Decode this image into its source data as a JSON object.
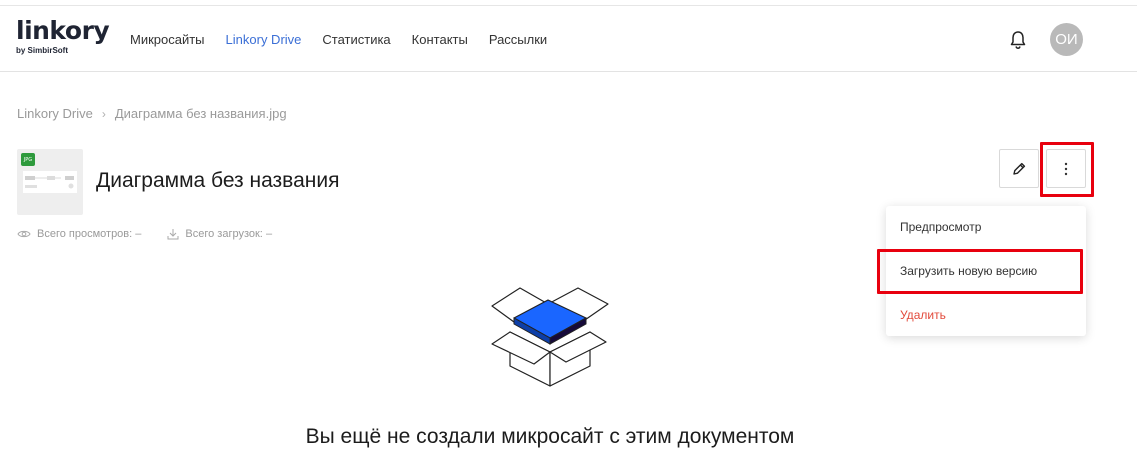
{
  "header": {
    "logo_text": "linkory",
    "logo_sub": "by SimbirSoft",
    "nav": [
      {
        "label": "Микросайты"
      },
      {
        "label": "Linkory Drive",
        "active": true
      },
      {
        "label": "Статистика"
      },
      {
        "label": "Контакты"
      },
      {
        "label": "Рассылки"
      }
    ],
    "bell_icon": "bell-icon",
    "avatar_initials": "ОИ"
  },
  "breadcrumb": {
    "root": "Linkory Drive",
    "current": "Диаграмма без названия.jpg"
  },
  "document": {
    "title": "Диаграмма без названия",
    "thumb_badge": "JPG",
    "views_label": "Всего просмотров:",
    "views_value": "–",
    "downloads_label": "Всего загрузок:",
    "downloads_value": "–"
  },
  "actions": {
    "edit_icon": "pencil-icon",
    "more_icon": "kebab-icon"
  },
  "menu": {
    "preview": "Предпросмотр",
    "upload_new_version": "Загрузить новую версию",
    "delete": "Удалить"
  },
  "empty_state": {
    "text": "Вы ещё не создали микросайт с этим документом"
  },
  "colors": {
    "accent": "#3b6fd6",
    "danger": "#e24a3b",
    "highlight": "#e8000e",
    "box_blue": "#1a66ff"
  }
}
